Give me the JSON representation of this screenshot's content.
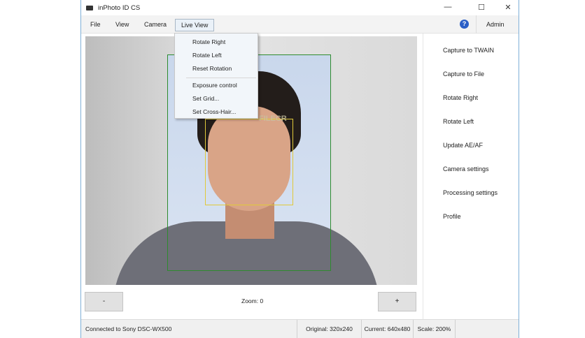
{
  "window": {
    "title": "inPhoto ID CS",
    "minimize": "—",
    "maximize": "☐",
    "close": "✕"
  },
  "menu": {
    "items": [
      "File",
      "View",
      "Camera",
      "Live View"
    ],
    "help": "?",
    "admin": "Admin"
  },
  "dropdown": {
    "items": [
      "Rotate Right",
      "Rotate Left",
      "Reset Rotation",
      "Exposure control",
      "Set Grid...",
      "Set Cross-Hair..."
    ]
  },
  "viewer": {
    "watermark": "FILECR",
    "zoom_out": "-",
    "zoom_in": "+",
    "zoom_label": "Zoom: 0"
  },
  "actions": [
    "Capture to TWAIN",
    "Capture to File",
    "Rotate Right",
    "Rotate Left",
    "Update AE/AF",
    "Camera settings",
    "Processing settings",
    "Profile"
  ],
  "status": {
    "connection": "Connected to Sony DSC-WX500",
    "original": "Original: 320x240",
    "current": "Current: 640x480",
    "scale": "Scale: 200%"
  }
}
